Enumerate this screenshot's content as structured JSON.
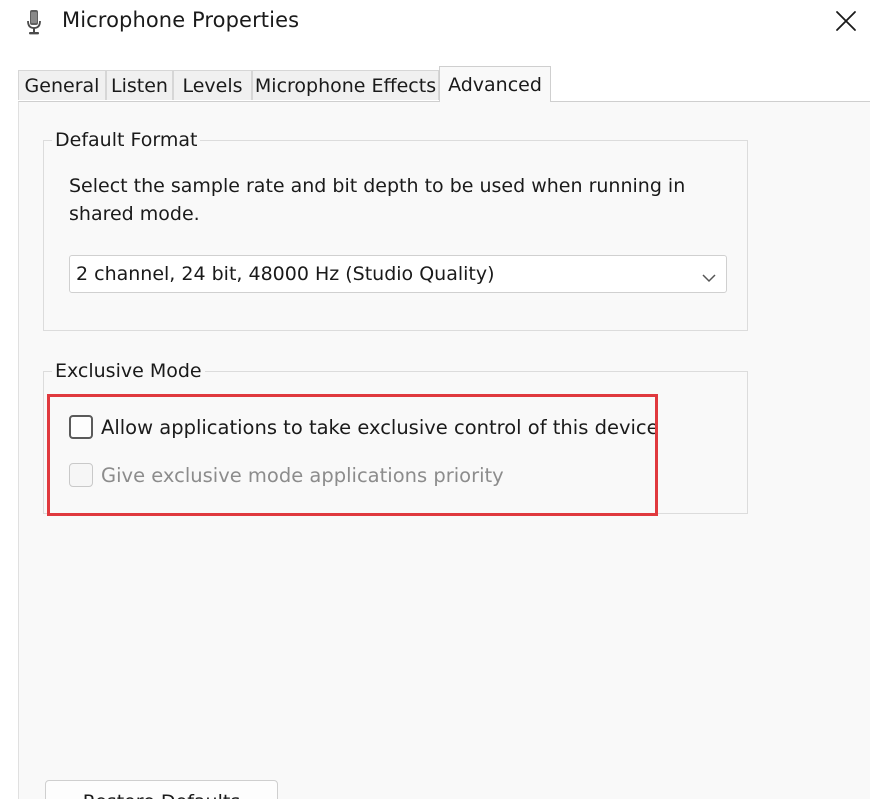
{
  "window": {
    "title": "Microphone Properties",
    "icon": "microphone-icon",
    "close_icon": "close-icon"
  },
  "tabs": [
    {
      "label": "General",
      "active": false
    },
    {
      "label": "Listen",
      "active": false
    },
    {
      "label": "Levels",
      "active": false
    },
    {
      "label": "Microphone Effects",
      "active": false
    },
    {
      "label": "Advanced",
      "active": true
    }
  ],
  "default_format": {
    "group_label": "Default Format",
    "description": "Select the sample rate and bit depth to be used when running in shared mode.",
    "selected_format": "2 channel, 24 bit, 48000 Hz (Studio Quality)",
    "dropdown_icon": "chevron-down-icon"
  },
  "exclusive_mode": {
    "group_label": "Exclusive Mode",
    "allow_exclusive": {
      "label": "Allow applications to take exclusive control of this device",
      "checked": false,
      "enabled": true
    },
    "give_priority": {
      "label": "Give exclusive mode applications priority",
      "checked": false,
      "enabled": false
    }
  },
  "footer": {
    "restore_defaults_label": "Restore Defaults"
  },
  "colors": {
    "highlight": "#e0393e",
    "panel_bg": "#f9f9f9",
    "disabled_text": "#8c8c8c"
  }
}
